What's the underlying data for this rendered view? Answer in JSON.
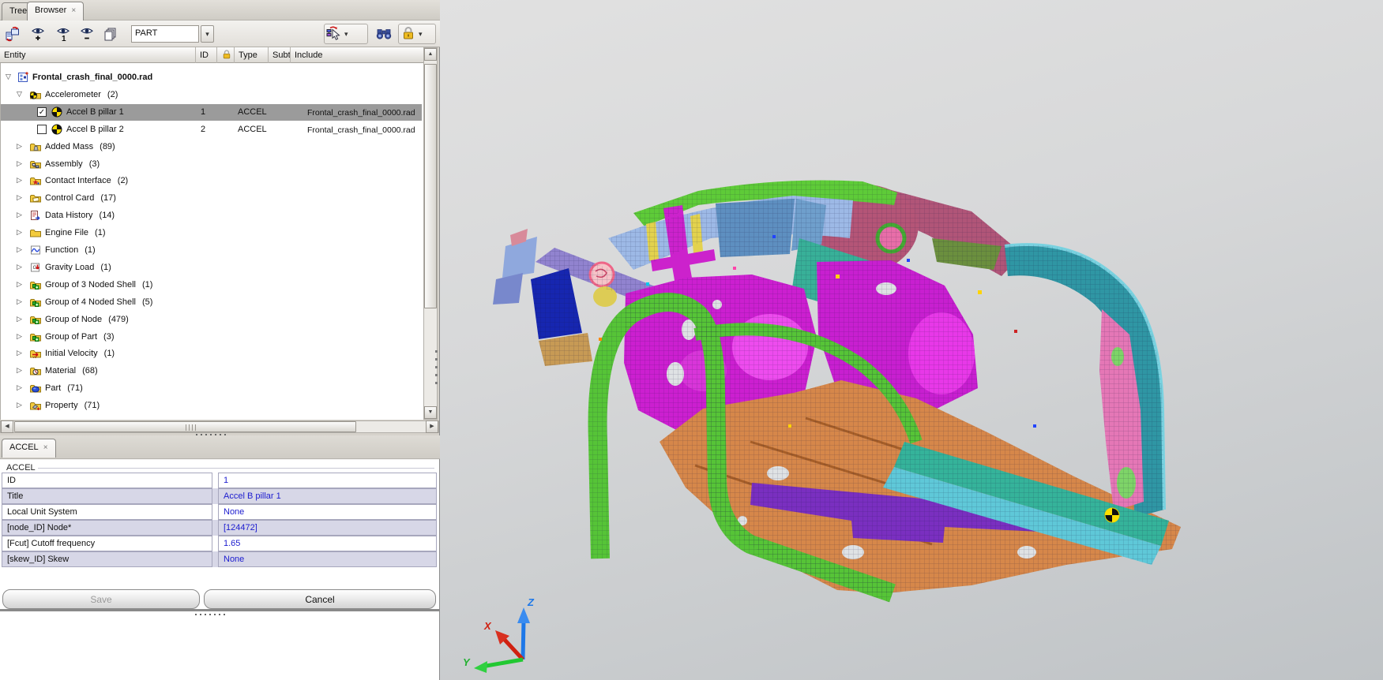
{
  "tabs": {
    "tree": "Tree",
    "browser": "Browser",
    "close_glyph": "×"
  },
  "toolbar": {
    "filter_value": "PART",
    "dropdown_glyph": "▾",
    "left_icons": [
      "browser-config-icon",
      "show-icon",
      "isolate-icon",
      "hide-icon",
      "collector-stack-icon"
    ],
    "right_icons": [
      "selector-tool-icon",
      "find-icon",
      "lock-icon"
    ]
  },
  "columns": {
    "entity": "Entity",
    "id": "ID",
    "lock": "lock-icon",
    "type": "Type",
    "subtype": "Subtype",
    "include": "Include"
  },
  "tree": {
    "rows": [
      {
        "label": "Frontal_crash_final_0000.rad",
        "count": "",
        "depth": 0,
        "expander": "open",
        "icon": "model-icon",
        "bold": true
      },
      {
        "label": "Accelerometer",
        "count": "(2)",
        "depth": 1,
        "expander": "open",
        "icon": "accelerometer-folder-icon"
      },
      {
        "label": "Accel B pillar 1",
        "count": "",
        "depth": 2,
        "icon": "accelerometer-icon",
        "checkbox": "checked",
        "selected": true,
        "id": "1",
        "type": "ACCEL",
        "include": "Frontal_crash_final_0000.rad"
      },
      {
        "label": "Accel B pillar 2",
        "count": "",
        "depth": 2,
        "icon": "accelerometer-icon",
        "checkbox": "unchecked",
        "id": "2",
        "type": "ACCEL",
        "include": "Frontal_crash_final_0000.rad"
      },
      {
        "label": "Added Mass",
        "count": "(89)",
        "depth": 1,
        "expander": "closed",
        "icon": "added-mass-icon"
      },
      {
        "label": "Assembly",
        "count": "(3)",
        "depth": 1,
        "expander": "closed",
        "icon": "assembly-icon"
      },
      {
        "label": "Contact Interface",
        "count": "(2)",
        "depth": 1,
        "expander": "closed",
        "icon": "contact-interface-icon"
      },
      {
        "label": "Control Card",
        "count": "(17)",
        "depth": 1,
        "expander": "closed",
        "icon": "control-card-icon"
      },
      {
        "label": "Data History",
        "count": "(14)",
        "depth": 1,
        "expander": "closed",
        "icon": "data-history-icon"
      },
      {
        "label": "Engine File",
        "count": "(1)",
        "depth": 1,
        "expander": "closed",
        "icon": "engine-file-icon"
      },
      {
        "label": "Function",
        "count": "(1)",
        "depth": 1,
        "expander": "closed",
        "icon": "function-icon"
      },
      {
        "label": "Gravity Load",
        "count": "(1)",
        "depth": 1,
        "expander": "closed",
        "icon": "gravity-load-icon"
      },
      {
        "label": "Group of 3 Noded Shell",
        "count": "(1)",
        "depth": 1,
        "expander": "closed",
        "icon": "group-icon"
      },
      {
        "label": "Group of 4 Noded Shell",
        "count": "(5)",
        "depth": 1,
        "expander": "closed",
        "icon": "group-icon"
      },
      {
        "label": "Group of Node",
        "count": "(479)",
        "depth": 1,
        "expander": "closed",
        "icon": "group-icon"
      },
      {
        "label": "Group of Part",
        "count": "(3)",
        "depth": 1,
        "expander": "closed",
        "icon": "group-icon"
      },
      {
        "label": "Initial Velocity",
        "count": "(1)",
        "depth": 1,
        "expander": "closed",
        "icon": "initial-velocity-icon"
      },
      {
        "label": "Material",
        "count": "(68)",
        "depth": 1,
        "expander": "closed",
        "icon": "material-icon"
      },
      {
        "label": "Part",
        "count": "(71)",
        "depth": 1,
        "expander": "closed",
        "icon": "part-icon"
      },
      {
        "label": "Property",
        "count": "(71)",
        "depth": 1,
        "expander": "closed",
        "icon": "property-icon"
      }
    ]
  },
  "card": {
    "tab": "ACCEL",
    "close_glyph": "×",
    "group_title": "ACCEL",
    "rows": [
      {
        "label": "ID",
        "value": "1"
      },
      {
        "label": "Title",
        "value": "Accel B pillar 1"
      },
      {
        "label": "Local Unit System",
        "value": "None"
      },
      {
        "label": "[node_ID] Node*",
        "value": "[124472]"
      },
      {
        "label": "[Fcut] Cutoff frequency",
        "value": "1.65"
      },
      {
        "label": "[skew_ID] Skew",
        "value": "None"
      }
    ],
    "save_label": "Save",
    "cancel_label": "Cancel"
  },
  "axis": {
    "x": "X",
    "y": "Y",
    "z": "Z"
  },
  "colors": {
    "selection_bg": "#9b9b9b",
    "value_text": "#1c1ccf",
    "row_shade": "#d7d7e7",
    "folder": "#f3cb3d",
    "axis_x": "#cc2211",
    "axis_y": "#22bb33",
    "axis_z": "#2277ee",
    "viewport_top": "#e1e1e1",
    "viewport_bottom": "#bfc3c6",
    "model_palette": [
      "#5ecb38",
      "#9db9e6",
      "#cc1fd0",
      "#d6874a",
      "#7a2fc0",
      "#2f96a4",
      "#35b39a",
      "#e577b6",
      "#b45577",
      "#1626b0",
      "#e3d24d",
      "#5e8fc0"
    ]
  }
}
